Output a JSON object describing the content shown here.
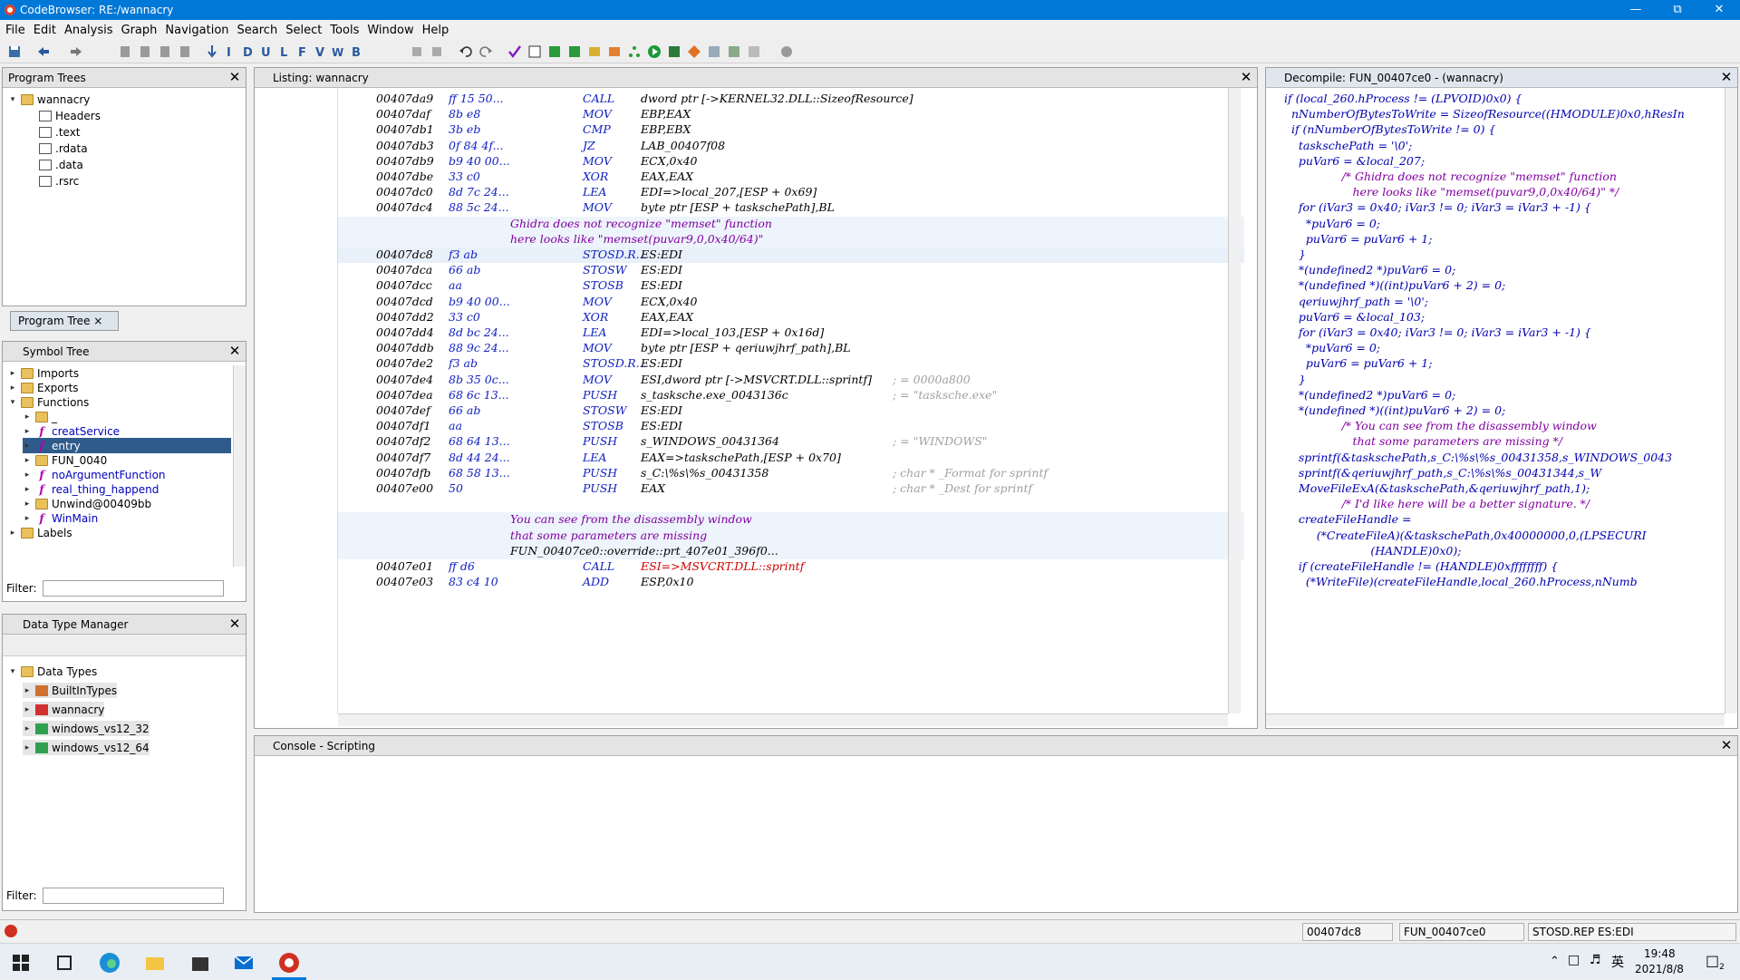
{
  "window": {
    "title": "CodeBrowser: RE:/wannacry"
  },
  "menu": [
    "File",
    "Edit",
    "Analysis",
    "Graph",
    "Navigation",
    "Search",
    "Select",
    "Tools",
    "Window",
    "Help"
  ],
  "program_trees": {
    "title": "Program Trees",
    "root": "wannacry",
    "items": [
      "Headers",
      ".text",
      ".rdata",
      ".data",
      ".rsrc"
    ],
    "tab": "Program Tree"
  },
  "symbol_tree": {
    "title": "Symbol Tree",
    "items": [
      {
        "label": "Imports",
        "kind": "folder",
        "indent": 0
      },
      {
        "label": "Exports",
        "kind": "folder",
        "indent": 0
      },
      {
        "label": "Functions",
        "kind": "folder",
        "indent": 0,
        "open": true
      },
      {
        "label": "_",
        "kind": "folder",
        "indent": 1
      },
      {
        "label": "creatService",
        "kind": "func",
        "indent": 1
      },
      {
        "label": "entry",
        "kind": "func",
        "indent": 1,
        "selected": true
      },
      {
        "label": "FUN_0040",
        "kind": "folder",
        "indent": 1
      },
      {
        "label": "noArgumentFunction",
        "kind": "func",
        "indent": 1
      },
      {
        "label": "real_thing_happend",
        "kind": "func",
        "indent": 1
      },
      {
        "label": "Unwind@00409bb",
        "kind": "folder",
        "indent": 1
      },
      {
        "label": "WinMain",
        "kind": "func",
        "indent": 1
      },
      {
        "label": "Labels",
        "kind": "folder",
        "indent": 0
      }
    ],
    "filter_label": "Filter:"
  },
  "data_type_manager": {
    "title": "Data Type Manager",
    "root": "Data Types",
    "items": [
      "BuiltInTypes",
      "wannacry",
      "windows_vs12_32",
      "windows_vs12_64"
    ],
    "filter_label": "Filter:"
  },
  "listing": {
    "title": "Listing:  wannacry",
    "rows": [
      {
        "addr": "00407da9",
        "bytes": "ff 15 50...",
        "mnem": "CALL",
        "ops": "dword ptr [->KERNEL32.DLL::SizeofResource]",
        "cmt": ""
      },
      {
        "addr": "00407daf",
        "bytes": "8b e8",
        "mnem": "MOV",
        "ops": "EBP,EAX",
        "cmt": ""
      },
      {
        "addr": "00407db1",
        "bytes": "3b eb",
        "mnem": "CMP",
        "ops": "EBP,EBX",
        "cmt": ""
      },
      {
        "addr": "00407db3",
        "bytes": "0f 84 4f...",
        "mnem": "JZ",
        "ops": "LAB_00407f08",
        "cmt": ""
      },
      {
        "addr": "00407db9",
        "bytes": "b9 40 00...",
        "mnem": "MOV",
        "ops": "ECX,0x40",
        "cmt": ""
      },
      {
        "addr": "00407dbe",
        "bytes": "33 c0",
        "mnem": "XOR",
        "ops": "EAX,EAX",
        "cmt": ""
      },
      {
        "addr": "00407dc0",
        "bytes": "8d 7c 24...",
        "mnem": "LEA",
        "ops": "EDI=>local_207,[ESP + 0x69]",
        "cmt": ""
      },
      {
        "addr": "00407dc4",
        "bytes": "88 5c 24...",
        "mnem": "MOV",
        "ops": "byte ptr [ESP + taskschePath],BL",
        "cmt": ""
      }
    ],
    "pre_comment_1": [
      "Ghidra does not recognize \"memset\" function",
      "here looks like \"memset(puvar9,0,0x40/64)\""
    ],
    "rows2": [
      {
        "addr": "00407dc8",
        "bytes": "f3 ab",
        "mnem": "STOSD.R...",
        "ops": "ES:EDI",
        "cmt": ""
      },
      {
        "addr": "00407dca",
        "bytes": "66 ab",
        "mnem": "STOSW",
        "ops": "ES:EDI",
        "cmt": ""
      },
      {
        "addr": "00407dcc",
        "bytes": "aa",
        "mnem": "STOSB",
        "ops": "ES:EDI",
        "cmt": ""
      },
      {
        "addr": "00407dcd",
        "bytes": "b9 40 00...",
        "mnem": "MOV",
        "ops": "ECX,0x40",
        "cmt": ""
      },
      {
        "addr": "00407dd2",
        "bytes": "33 c0",
        "mnem": "XOR",
        "ops": "EAX,EAX",
        "cmt": ""
      },
      {
        "addr": "00407dd4",
        "bytes": "8d bc 24...",
        "mnem": "LEA",
        "ops": "EDI=>local_103,[ESP + 0x16d]",
        "cmt": ""
      },
      {
        "addr": "00407ddb",
        "bytes": "88 9c 24...",
        "mnem": "MOV",
        "ops": "byte ptr [ESP + qeriuwjhrf_path],BL",
        "cmt": ""
      },
      {
        "addr": "00407de2",
        "bytes": "f3 ab",
        "mnem": "STOSD.R...",
        "ops": "ES:EDI",
        "cmt": ""
      },
      {
        "addr": "00407de4",
        "bytes": "8b 35 0c...",
        "mnem": "MOV",
        "ops": "ESI,dword ptr [->MSVCRT.DLL::sprintf]",
        "cmt": "; = 0000a800"
      },
      {
        "addr": "00407dea",
        "bytes": "68 6c 13...",
        "mnem": "PUSH",
        "ops": "s_tasksche.exe_0043136c",
        "cmt": "; = \"tasksche.exe\""
      },
      {
        "addr": "00407def",
        "bytes": "66 ab",
        "mnem": "STOSW",
        "ops": "ES:EDI",
        "cmt": ""
      },
      {
        "addr": "00407df1",
        "bytes": "aa",
        "mnem": "STOSB",
        "ops": "ES:EDI",
        "cmt": ""
      },
      {
        "addr": "00407df2",
        "bytes": "68 64 13...",
        "mnem": "PUSH",
        "ops": "s_WINDOWS_00431364",
        "cmt": "; = \"WINDOWS\""
      },
      {
        "addr": "00407df7",
        "bytes": "8d 44 24...",
        "mnem": "LEA",
        "ops": "EAX=>taskschePath,[ESP + 0x70]",
        "cmt": ""
      },
      {
        "addr": "00407dfb",
        "bytes": "68 58 13...",
        "mnem": "PUSH",
        "ops": "s_C:\\%s\\%s_00431358",
        "cmt": "; char * _Format for sprintf"
      },
      {
        "addr": "00407e00",
        "bytes": "50",
        "mnem": "PUSH",
        "ops": "EAX",
        "cmt": "; char * _Dest for sprintf"
      }
    ],
    "pre_comment_2": [
      "You can see from the disassembly window",
      "that some parameters are missing",
      "FUN_00407ce0::override::prt_407e01_396f0..."
    ],
    "rows3": [
      {
        "addr": "00407e01",
        "bytes": "ff d6",
        "mnem": "CALL",
        "ops": "ESI=>MSVCRT.DLL::sprintf",
        "cmt": ""
      },
      {
        "addr": "00407e03",
        "bytes": "83 c4 10",
        "mnem": "ADD",
        "ops": "ESP,0x10",
        "cmt": ""
      }
    ]
  },
  "decompile": {
    "title": "Decompile: FUN_00407ce0 - (wannacry)",
    "lines": [
      "if (local_260.hProcess != (LPVOID)0x0) {",
      "  nNumberOfBytesToWrite = SizeofResource((HMODULE)0x0,hResIn",
      "  if (nNumberOfBytesToWrite != 0) {",
      "    taskschePath = '\\0';",
      "    puVar6 = &local_207;",
      "                /* Ghidra does not recognize \"memset\" function",
      "                   here looks like \"memset(puvar9,0,0x40/64)\" */",
      "    for (iVar3 = 0x40; iVar3 != 0; iVar3 = iVar3 + -1) {",
      "      *puVar6 = 0;",
      "      puVar6 = puVar6 + 1;",
      "    }",
      "    *(undefined2 *)puVar6 = 0;",
      "    *(undefined *)((int)puVar6 + 2) = 0;",
      "    qeriuwjhrf_path = '\\0';",
      "    puVar6 = &local_103;",
      "    for (iVar3 = 0x40; iVar3 != 0; iVar3 = iVar3 + -1) {",
      "      *puVar6 = 0;",
      "      puVar6 = puVar6 + 1;",
      "    }",
      "    *(undefined2 *)puVar6 = 0;",
      "    *(undefined *)((int)puVar6 + 2) = 0;",
      "                /* You can see from the disassembly window",
      "                   that some parameters are missing */",
      "    sprintf(&taskschePath,s_C:\\%s\\%s_00431358,s_WINDOWS_0043",
      "    sprintf(&qeriuwjhrf_path,s_C:\\%s\\%s_00431344,s_W",
      "    MoveFileExA(&taskschePath,&qeriuwjhrf_path,1);",
      "                /* I'd like here will be a better signature. */",
      "    createFileHandle =",
      "         (*CreateFileA)(&taskschePath,0x40000000,0,(LPSECURI",
      "                        (HANDLE)0x0);",
      "    if (createFileHandle != (HANDLE)0xffffffff) {",
      "      (*WriteFile)(createFileHandle,local_260.hProcess,nNumb"
    ]
  },
  "console": {
    "title": "Console - Scripting"
  },
  "status": {
    "address": "00407dc8",
    "function": "FUN_00407ce0",
    "instruction": "STOSD.REP ES:EDI"
  },
  "taskbar": {
    "time": "19:48",
    "date": "2021/8/8",
    "ime": "英",
    "notif_count": "2"
  }
}
